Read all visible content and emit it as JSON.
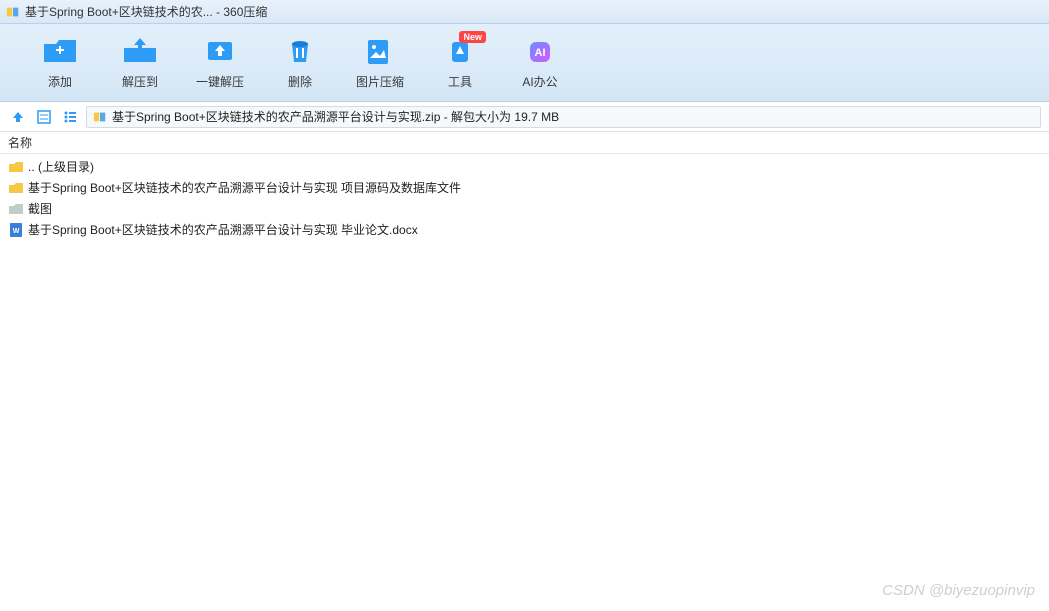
{
  "titlebar": {
    "text": "基于Spring Boot+区块链技术的农... - 360压缩"
  },
  "toolbar": {
    "items": [
      {
        "label": "添加",
        "icon": "add"
      },
      {
        "label": "解压到",
        "icon": "extract-to"
      },
      {
        "label": "一键解压",
        "icon": "extract-one"
      },
      {
        "label": "删除",
        "icon": "delete"
      },
      {
        "label": "图片压缩",
        "icon": "image-compress"
      },
      {
        "label": "工具",
        "icon": "tools",
        "badge": "New"
      },
      {
        "label": "AI办公",
        "icon": "ai"
      }
    ]
  },
  "pathbar": {
    "text": "基于Spring Boot+区块链技术的农产品溯源平台设计与实现.zip - 解包大小为 19.7 MB"
  },
  "columns": {
    "name": "名称"
  },
  "files": [
    {
      "type": "up",
      "name": ".. (上级目录)"
    },
    {
      "type": "folder-yellow",
      "name": "基于Spring Boot+区块链技术的农产品溯源平台设计与实现 项目源码及数据库文件"
    },
    {
      "type": "folder-gray",
      "name": "截图"
    },
    {
      "type": "docx",
      "name": "基于Spring Boot+区块链技术的农产品溯源平台设计与实现 毕业论文.docx"
    }
  ],
  "watermark": "CSDN @biyezuopinvip"
}
